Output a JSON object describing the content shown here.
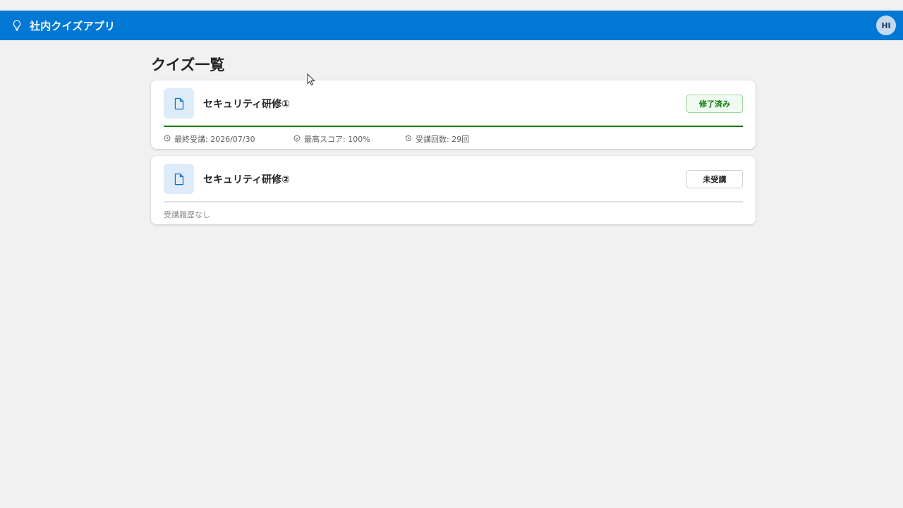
{
  "header": {
    "app_title": "社内クイズアプリ",
    "avatar_initials": "HI",
    "accent_color": "#0078d4",
    "bulb_icon": "lightbulb-icon"
  },
  "main": {
    "page_title": "クイズ一覧"
  },
  "quizzes": [
    {
      "title": "セキュリティ研修①",
      "icon": "document-icon",
      "status": "修了済み",
      "status_color": "#107c10",
      "progress": 1.0,
      "last_taken": "最終受講: 2026/07/30",
      "best_score": "最高スコア: 100%",
      "attempts": "受講回数: 29回"
    },
    {
      "title": "セキュリティ研修②",
      "icon": "document-icon",
      "status": "未受講",
      "progress": 0,
      "no_history": "受講履歴なし"
    }
  ]
}
